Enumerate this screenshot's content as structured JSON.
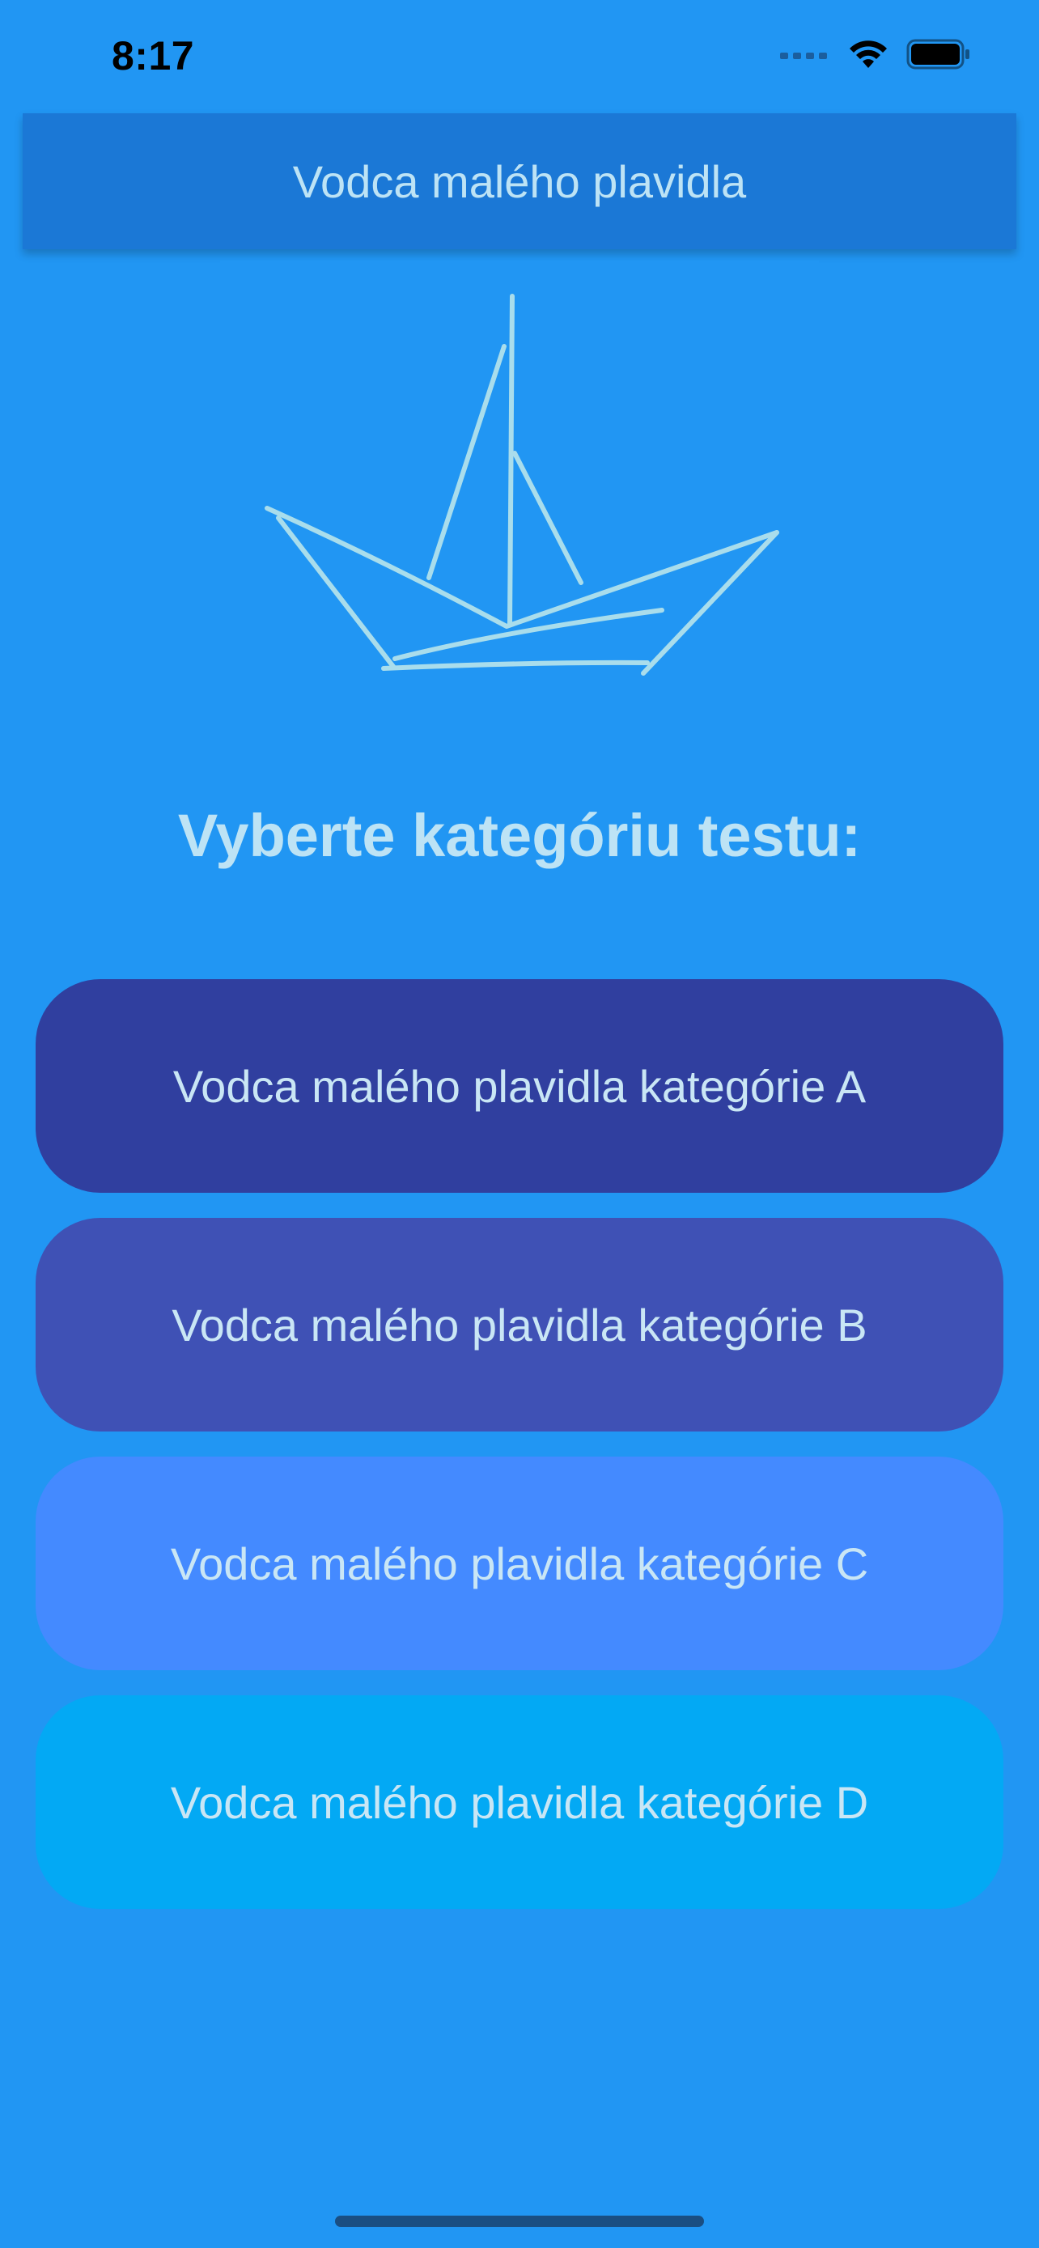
{
  "status_bar": {
    "time": "8:17",
    "icons": [
      "signal-icon",
      "wifi-icon",
      "battery-icon"
    ]
  },
  "app_bar": {
    "title": "Vodca malého plavidla"
  },
  "logo": {
    "icon": "sailboat-sketch-icon",
    "color": "#A9DDEC"
  },
  "prompt": "Vyberte kategóriu testu:",
  "categories": [
    {
      "label": "Vodca malého plavidla kategórie A",
      "color": "#303F9F"
    },
    {
      "label": "Vodca malého plavidla kategórie B",
      "color": "#3F51B5"
    },
    {
      "label": "Vodca malého plavidla kategórie C",
      "color": "#448AFF"
    },
    {
      "label": "Vodca malého plavidla kategórie D",
      "color": "#03A9F4"
    }
  ],
  "colors": {
    "background": "#2196F3",
    "app_bar": "#1B78D6",
    "text": "#BDE3F5"
  }
}
